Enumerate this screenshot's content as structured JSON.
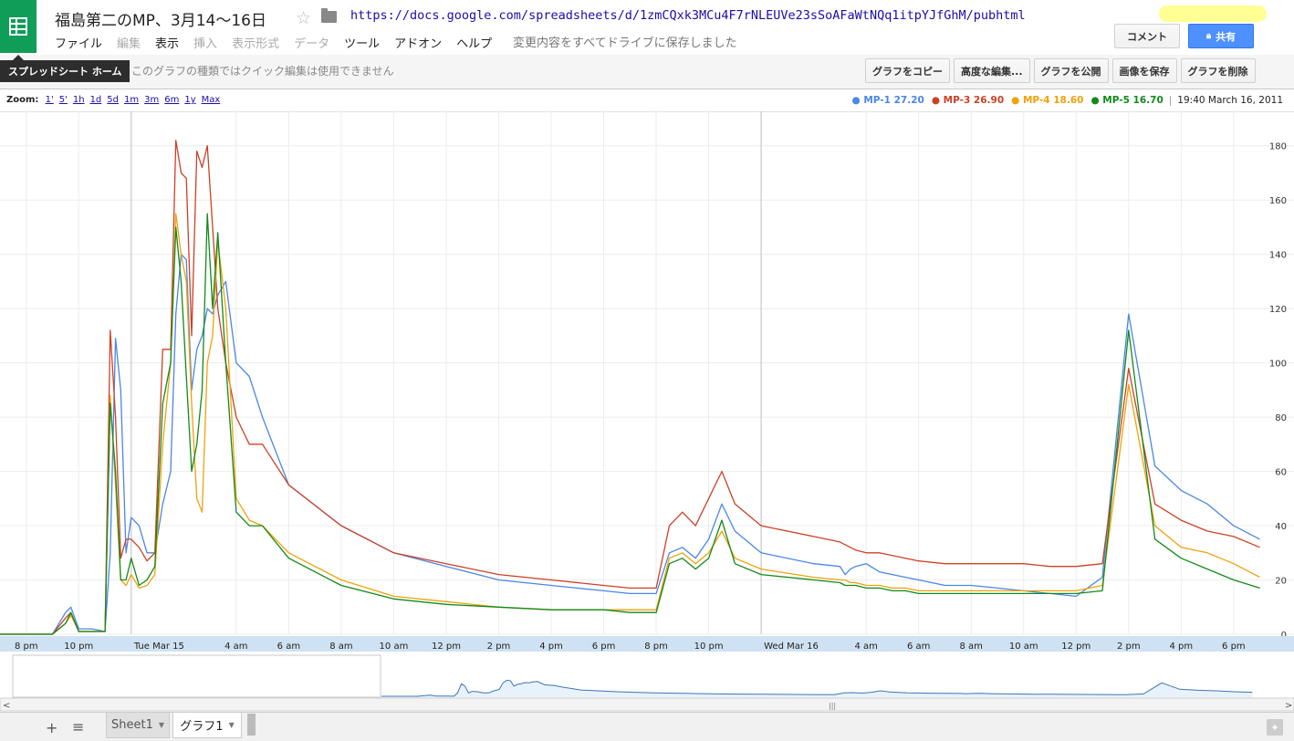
{
  "header": {
    "title": "福島第二のMP、3月14～16日",
    "url": "https://docs.google.com/spreadsheets/d/1zmCQxk3MCu4F7rNLEUVe23sSoAFaWtNQq1itpYJfGhM/pubhtml",
    "save_status": "変更内容をすべてドライブに保存しました",
    "comment_button": "コメント",
    "share_button": "共有",
    "menu": [
      {
        "label": "ファイル",
        "enabled": true
      },
      {
        "label": "編集",
        "enabled": false
      },
      {
        "label": "表示",
        "enabled": true
      },
      {
        "label": "挿入",
        "enabled": false
      },
      {
        "label": "表示形式",
        "enabled": false
      },
      {
        "label": "データ",
        "enabled": false
      },
      {
        "label": "ツール",
        "enabled": true
      },
      {
        "label": "アドオン",
        "enabled": true
      },
      {
        "label": "ヘルプ",
        "enabled": true
      }
    ]
  },
  "toolbar": {
    "home_tooltip": "スプレッドシート ホーム",
    "quick_edit_message": "このグラフの種類ではクイック編集は使用できません",
    "chart_buttons": [
      "グラフをコピー",
      "高度な編集...",
      "グラフを公開",
      "画像を保存",
      "グラフを削除"
    ]
  },
  "zoom": {
    "label": "Zoom:",
    "options": [
      "1'",
      "5'",
      "1h",
      "1d",
      "5d",
      "1m",
      "3m",
      "6m",
      "1y",
      "Max"
    ]
  },
  "legend_time": "19:40 March 16, 2011",
  "colors": {
    "MP-1": "#4a86e8",
    "MP-3": "#cc4125",
    "MP-4": "#f1a10a",
    "MP-5": "#128a1a",
    "brand": "#0f9d58",
    "share": "#4d90fe"
  },
  "chart_data": {
    "type": "line",
    "title": "",
    "xlabel": "",
    "ylabel": "",
    "ylim": [
      0,
      190
    ],
    "y_ticks": [
      0,
      20,
      40,
      60,
      80,
      100,
      120,
      140,
      160,
      180
    ],
    "x_ticks": [
      "8 pm",
      "10 pm",
      "Tue Mar 15",
      "4 am",
      "6 am",
      "8 am",
      "10 am",
      "12 pm",
      "2 pm",
      "4 pm",
      "6 pm",
      "8 pm",
      "10 pm",
      "Wed Mar 16",
      "4 am",
      "6 am",
      "8 am",
      "10 am",
      "12 pm",
      "2 pm",
      "4 pm",
      "6 pm"
    ],
    "x_unit": "hours since Mar 14 00:00",
    "xlim": [
      19,
      43.8
    ],
    "series": [
      {
        "name": "MP-1",
        "legend_value": "27.20",
        "x": [
          19.0,
          20.0,
          21.0,
          21.5,
          21.7,
          22.0,
          22.5,
          23.0,
          23.2,
          23.4,
          23.6,
          23.8,
          24.0,
          24.3,
          24.6,
          24.9,
          25.2,
          25.5,
          25.7,
          25.9,
          26.1,
          26.3,
          26.5,
          26.7,
          26.9,
          27.1,
          27.3,
          27.6,
          28.0,
          28.5,
          29.0,
          30.0,
          32.0,
          34.0,
          36.0,
          38.0,
          40.0,
          42.0,
          43.0,
          43.3,
          43.6,
          43.8,
          44.0,
          44.5,
          45.0,
          45.5,
          46.0,
          46.5,
          47.0,
          48.0,
          50.0,
          51.0,
          51.2,
          51.4,
          51.6,
          52.0,
          52.5,
          53.0,
          53.5,
          54.0,
          55.0,
          56.0,
          57.0,
          58.0,
          59.0,
          60.0,
          61.0,
          62.0,
          63.0,
          64.0,
          65.0,
          66.0,
          67.0
        ],
        "y": [
          0,
          0,
          0,
          8,
          10,
          2,
          2,
          1,
          30,
          109,
          90,
          30,
          43,
          40,
          30,
          30,
          48,
          60,
          118,
          140,
          138,
          90,
          105,
          110,
          120,
          118,
          125,
          130,
          100,
          95,
          80,
          55,
          40,
          30,
          25,
          20,
          18,
          16,
          15,
          15,
          15,
          15,
          15,
          30,
          32,
          28,
          35,
          48,
          38,
          30,
          26,
          25,
          22,
          24,
          25,
          26,
          23,
          22,
          21,
          20,
          18,
          18,
          17,
          16,
          15,
          14,
          21,
          118,
          62,
          53,
          48,
          40,
          35
        ]
      },
      {
        "name": "MP-3",
        "legend_value": "26.90",
        "x": [
          19.0,
          20.0,
          21.0,
          21.5,
          21.7,
          22.0,
          22.5,
          23.0,
          23.2,
          23.4,
          23.6,
          23.8,
          24.0,
          24.3,
          24.6,
          24.9,
          25.2,
          25.5,
          25.7,
          25.9,
          26.1,
          26.3,
          26.5,
          26.7,
          26.9,
          27.1,
          27.3,
          27.6,
          28.0,
          28.5,
          29.0,
          30.0,
          32.0,
          34.0,
          36.0,
          38.0,
          40.0,
          42.0,
          43.0,
          43.3,
          43.6,
          43.8,
          44.0,
          44.5,
          45.0,
          45.5,
          46.0,
          46.5,
          47.0,
          48.0,
          50.0,
          51.0,
          51.2,
          51.4,
          51.6,
          52.0,
          52.5,
          53.0,
          53.5,
          54.0,
          55.0,
          56.0,
          57.0,
          58.0,
          59.0,
          60.0,
          61.0,
          62.0,
          63.0,
          64.0,
          65.0,
          66.0,
          67.0
        ],
        "y": [
          0,
          0,
          0,
          6,
          8,
          1,
          1,
          1,
          112,
          80,
          28,
          35,
          35,
          32,
          27,
          30,
          105,
          105,
          182,
          170,
          168,
          110,
          178,
          172,
          180,
          150,
          120,
          100,
          80,
          70,
          70,
          55,
          40,
          30,
          26,
          22,
          20,
          18,
          17,
          17,
          17,
          17,
          17,
          40,
          45,
          40,
          50,
          60,
          48,
          40,
          36,
          34,
          33,
          32,
          31,
          30,
          30,
          29,
          28,
          27,
          26,
          26,
          26,
          26,
          25,
          25,
          26,
          98,
          48,
          42,
          38,
          36,
          32
        ]
      },
      {
        "name": "MP-4",
        "legend_value": "18.60",
        "x": [
          19.0,
          20.0,
          21.0,
          21.5,
          21.7,
          22.0,
          22.5,
          23.0,
          23.2,
          23.4,
          23.6,
          23.8,
          24.0,
          24.3,
          24.6,
          24.9,
          25.2,
          25.5,
          25.7,
          25.9,
          26.1,
          26.3,
          26.5,
          26.7,
          26.9,
          27.1,
          27.3,
          27.6,
          28.0,
          28.5,
          29.0,
          30.0,
          32.0,
          34.0,
          36.0,
          38.0,
          40.0,
          42.0,
          43.0,
          43.3,
          43.6,
          43.8,
          44.0,
          44.5,
          45.0,
          45.5,
          46.0,
          46.5,
          47.0,
          48.0,
          50.0,
          51.0,
          51.2,
          51.4,
          51.6,
          52.0,
          52.5,
          53.0,
          53.5,
          54.0,
          55.0,
          56.0,
          57.0,
          58.0,
          59.0,
          60.0,
          61.0,
          62.0,
          63.0,
          64.0,
          65.0,
          66.0,
          67.0
        ],
        "y": [
          0,
          0,
          0,
          4,
          7,
          1,
          1,
          1,
          88,
          55,
          20,
          18,
          22,
          17,
          18,
          22,
          70,
          100,
          155,
          140,
          130,
          85,
          50,
          45,
          100,
          110,
          145,
          120,
          50,
          42,
          40,
          30,
          20,
          14,
          12,
          10,
          9,
          9,
          9,
          9,
          9,
          9,
          9,
          28,
          30,
          26,
          30,
          38,
          28,
          24,
          21,
          20,
          20,
          19,
          19,
          18,
          18,
          17,
          17,
          16,
          16,
          16,
          16,
          16,
          16,
          16,
          18,
          92,
          40,
          32,
          30,
          26,
          21
        ]
      },
      {
        "name": "MP-5",
        "legend_value": "16.70",
        "x": [
          19.0,
          20.0,
          21.0,
          21.5,
          21.7,
          22.0,
          22.5,
          23.0,
          23.2,
          23.4,
          23.6,
          23.8,
          24.0,
          24.3,
          24.6,
          24.9,
          25.2,
          25.5,
          25.7,
          25.9,
          26.1,
          26.3,
          26.5,
          26.7,
          26.9,
          27.1,
          27.3,
          27.6,
          28.0,
          28.5,
          29.0,
          30.0,
          32.0,
          34.0,
          36.0,
          38.0,
          40.0,
          42.0,
          43.0,
          43.3,
          43.6,
          43.8,
          44.0,
          44.5,
          45.0,
          45.5,
          46.0,
          46.5,
          47.0,
          48.0,
          50.0,
          51.0,
          51.2,
          51.4,
          51.6,
          52.0,
          52.5,
          53.0,
          53.5,
          54.0,
          55.0,
          56.0,
          57.0,
          58.0,
          59.0,
          60.0,
          61.0,
          62.0,
          63.0,
          64.0,
          65.0,
          66.0,
          67.0
        ],
        "y": [
          0,
          0,
          0,
          4,
          8,
          1,
          1,
          1,
          85,
          60,
          20,
          20,
          28,
          18,
          20,
          25,
          85,
          100,
          150,
          130,
          95,
          60,
          70,
          90,
          155,
          120,
          148,
          100,
          45,
          40,
          40,
          28,
          18,
          13,
          11,
          10,
          9,
          9,
          8,
          8,
          8,
          8,
          8,
          26,
          28,
          24,
          28,
          42,
          26,
          22,
          20,
          19,
          18,
          18,
          18,
          17,
          17,
          16,
          16,
          15,
          15,
          15,
          15,
          15,
          15,
          15,
          16,
          112,
          35,
          28,
          24,
          20,
          17
        ]
      }
    ]
  }
}
